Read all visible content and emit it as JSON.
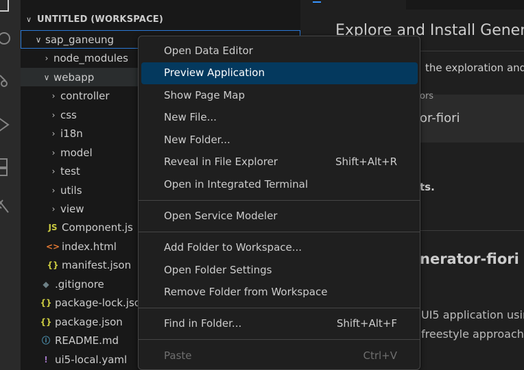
{
  "explorer": {
    "workspace_title": "UNTITLED (WORKSPACE)",
    "tree": [
      {
        "label": "sap_ganeung",
        "kind": "folder-open"
      },
      {
        "label": "node_modules",
        "kind": "folder-closed"
      },
      {
        "label": "webapp",
        "kind": "folder-open"
      },
      {
        "label": "controller",
        "kind": "folder-closed"
      },
      {
        "label": "css",
        "kind": "folder-closed"
      },
      {
        "label": "i18n",
        "kind": "folder-closed"
      },
      {
        "label": "model",
        "kind": "folder-closed"
      },
      {
        "label": "test",
        "kind": "folder-closed"
      },
      {
        "label": "utils",
        "kind": "folder-closed"
      },
      {
        "label": "view",
        "kind": "folder-closed"
      },
      {
        "label": "Component.js",
        "kind": "file",
        "icon": "JS",
        "icon_color": "#cbcb41"
      },
      {
        "label": "index.html",
        "kind": "file",
        "icon": "<>",
        "icon_color": "#e37933"
      },
      {
        "label": "manifest.json",
        "kind": "file",
        "icon": "{}",
        "icon_color": "#cbcb41"
      },
      {
        "label": ".gitignore",
        "kind": "file",
        "icon": "◆",
        "icon_color": "#6d8086"
      },
      {
        "label": "package-lock.json",
        "kind": "file",
        "icon": "{}",
        "icon_color": "#cbcb41"
      },
      {
        "label": "package.json",
        "kind": "file",
        "icon": "{}",
        "icon_color": "#cbcb41"
      },
      {
        "label": "README.md",
        "kind": "file",
        "icon": "ⓘ",
        "icon_color": "#519aba"
      },
      {
        "label": "ui5-local.yaml",
        "kind": "file",
        "icon": "!",
        "icon_color": "#a074c4"
      }
    ]
  },
  "editor": {
    "heading": "Explore and Install Gener",
    "line_intro": "the exploration and",
    "ext_label": "ors",
    "ext_name": "or-fiori",
    "bold_text": "ts.",
    "section_title": "nerator-fiori",
    "body_line_1": "UI5 application usin",
    "body_line_2": "freestyle approach"
  },
  "context_menu": {
    "groups": [
      [
        {
          "label": "Open Data Editor",
          "shortcut": ""
        },
        {
          "label": "Preview Application",
          "shortcut": "",
          "active": true
        },
        {
          "label": "Show Page Map",
          "shortcut": ""
        },
        {
          "label": "New File...",
          "shortcut": ""
        },
        {
          "label": "New Folder...",
          "shortcut": ""
        },
        {
          "label": "Reveal in File Explorer",
          "shortcut": "Shift+Alt+R"
        },
        {
          "label": "Open in Integrated Terminal",
          "shortcut": ""
        }
      ],
      [
        {
          "label": "Open Service Modeler",
          "shortcut": ""
        }
      ],
      [
        {
          "label": "Add Folder to Workspace...",
          "shortcut": ""
        },
        {
          "label": "Open Folder Settings",
          "shortcut": ""
        },
        {
          "label": "Remove Folder from Workspace",
          "shortcut": ""
        }
      ],
      [
        {
          "label": "Find in Folder...",
          "shortcut": "Shift+Alt+F"
        }
      ],
      [
        {
          "label": "Paste",
          "shortcut": "Ctrl+V",
          "disabled": true
        }
      ]
    ]
  }
}
